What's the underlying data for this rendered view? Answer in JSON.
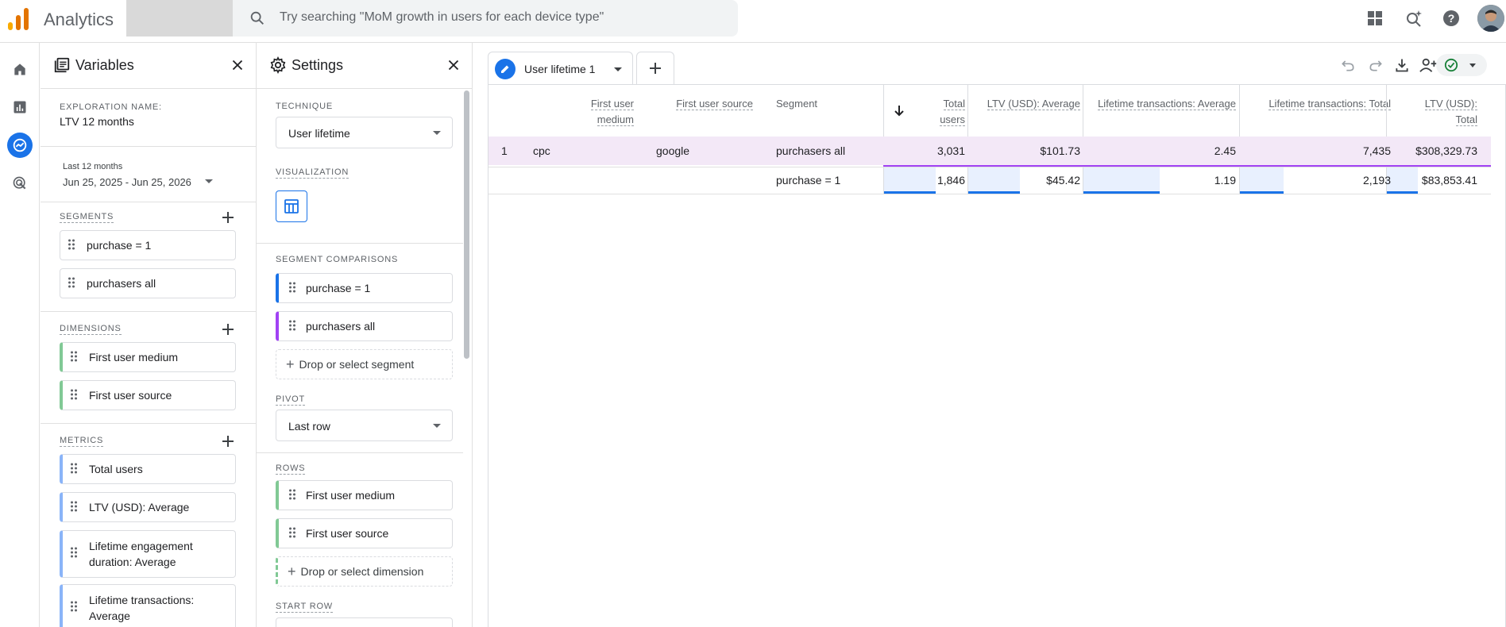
{
  "app": {
    "name": "Analytics",
    "search_placeholder": "Try searching \"MoM growth in users for each device type\""
  },
  "variables": {
    "title": "Variables",
    "exploration_label": "EXPLORATION NAME:",
    "exploration_name": "LTV 12 months",
    "date_range_label": "Last 12 months",
    "date_range": "Jun 25, 2025 - Jun 25, 2026",
    "segments_label": "SEGMENTS",
    "segments": [
      "purchase = 1",
      "purchasers all"
    ],
    "dimensions_label": "DIMENSIONS",
    "dimensions": [
      "First user medium",
      "First user source"
    ],
    "metrics_label": "METRICS",
    "metrics": [
      "Total users",
      "LTV (USD): Average",
      "Lifetime engagement duration: Average",
      "Lifetime transactions: Average"
    ]
  },
  "settings": {
    "title": "Settings",
    "technique_label": "TECHNIQUE",
    "technique": "User lifetime",
    "visualization_label": "VISUALIZATION",
    "segment_comparisons_label": "SEGMENT COMPARISONS",
    "segment_comparisons": [
      "purchase = 1",
      "purchasers all"
    ],
    "drop_segment": "Drop or select segment",
    "pivot_label": "PIVOT",
    "pivot": "Last row",
    "rows_label": "ROWS",
    "rows": [
      "First user medium",
      "First user source"
    ],
    "drop_dimension": "Drop or select dimension",
    "start_row_label": "START ROW"
  },
  "tab": {
    "label": "User lifetime 1"
  },
  "table": {
    "headers": {
      "medium": "First user medium",
      "source": "First user source",
      "segment": "Segment",
      "total_users": "Total users",
      "ltv_avg": "LTV (USD): Average",
      "lt_trans_avg": "Lifetime transactions: Average",
      "lt_trans_total": "Lifetime transactions: Total",
      "ltv_total": "LTV (USD): Total"
    },
    "rows": [
      {
        "index": "1",
        "medium": "cpc",
        "source": "google",
        "segment": "purchasers all",
        "total_users": "3,031",
        "ltv_avg": "$101.73",
        "lt_trans_avg": "2.45",
        "lt_trans_total": "7,435",
        "ltv_total": "$308,329.73"
      },
      {
        "index": "",
        "medium": "",
        "source": "",
        "segment": "purchase = 1",
        "total_users": "1,846",
        "ltv_avg": "$45.42",
        "lt_trans_avg": "1.19",
        "lt_trans_total": "2,193",
        "ltv_total": "$83,853.41"
      }
    ]
  },
  "colors": {
    "accent": "#1a73e8",
    "segment_purple": "#a142f4",
    "dimension_green": "#81c995",
    "metric_blue": "#8ab4f8"
  }
}
